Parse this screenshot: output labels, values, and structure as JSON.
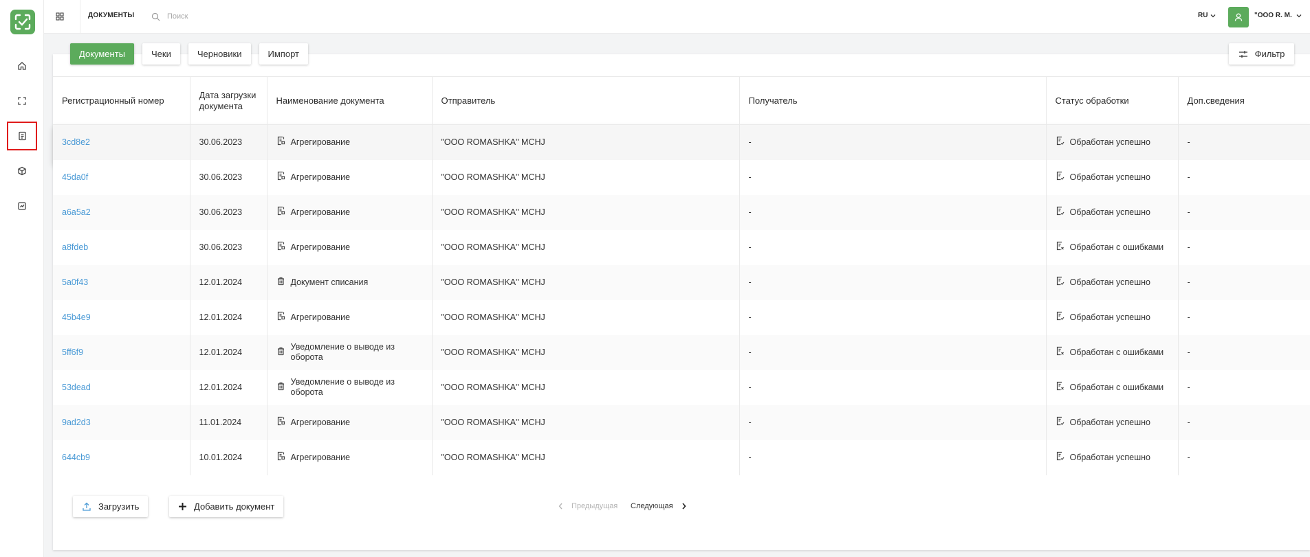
{
  "sidebar": {
    "logo": "check-frame-logo",
    "items": [
      {
        "icon": "home-icon"
      },
      {
        "icon": "scan-icon"
      },
      {
        "icon": "document-icon",
        "selected": true
      },
      {
        "icon": "box-icon"
      },
      {
        "icon": "report-icon"
      }
    ]
  },
  "header": {
    "title": "ДОКУМЕНТЫ",
    "search_placeholder": "Поиск",
    "lang": "RU",
    "user": "\"OOO R. M."
  },
  "tabs": [
    {
      "label": "Документы",
      "active": true
    },
    {
      "label": "Чеки",
      "active": false
    },
    {
      "label": "Черновики",
      "active": false
    },
    {
      "label": "Импорт",
      "active": false
    }
  ],
  "filter_label": "Фильтр",
  "table": {
    "columns": [
      "Регистрационный номер",
      "Дата загрузки документа",
      "Наименование документа",
      "Отправитель",
      "Получатель",
      "Статус обработки",
      "Доп.сведения"
    ],
    "rows": [
      {
        "reg": "3cd8e2",
        "date": "30.06.2023",
        "doc_icon": "aggregation-icon",
        "doc": "Агрегирование",
        "sender": "\"OOO ROMASHKA\" MCHJ",
        "recipient": "-",
        "status_icon": "status-ok-icon",
        "status": "Обработан успешно",
        "extra": "-"
      },
      {
        "reg": "45da0f",
        "date": "30.06.2023",
        "doc_icon": "aggregation-icon",
        "doc": "Агрегирование",
        "sender": "\"OOO ROMASHKA\" MCHJ",
        "recipient": "-",
        "status_icon": "status-ok-icon",
        "status": "Обработан успешно",
        "extra": "-"
      },
      {
        "reg": "a6a5a2",
        "date": "30.06.2023",
        "doc_icon": "aggregation-icon",
        "doc": "Агрегирование",
        "sender": "\"OOO ROMASHKA\" MCHJ",
        "recipient": "-",
        "status_icon": "status-ok-icon",
        "status": "Обработан успешно",
        "extra": "-"
      },
      {
        "reg": "a8fdeb",
        "date": "30.06.2023",
        "doc_icon": "aggregation-icon",
        "doc": "Агрегирование",
        "sender": "\"OOO ROMASHKA\" MCHJ",
        "recipient": "-",
        "status_icon": "status-error-icon",
        "status": "Обработан с ошибками",
        "extra": "-"
      },
      {
        "reg": "5a0f43",
        "date": "12.01.2024",
        "doc_icon": "trash-icon",
        "doc": "Документ списания",
        "sender": "\"OOO ROMASHKA\" MCHJ",
        "recipient": "-",
        "status_icon": "status-ok-icon",
        "status": "Обработан успешно",
        "extra": "-"
      },
      {
        "reg": "45b4e9",
        "date": "12.01.2024",
        "doc_icon": "aggregation-icon",
        "doc": "Агрегирование",
        "sender": "\"OOO ROMASHKA\" MCHJ",
        "recipient": "-",
        "status_icon": "status-ok-icon",
        "status": "Обработан успешно",
        "extra": "-"
      },
      {
        "reg": "5ff6f9",
        "date": "12.01.2024",
        "doc_icon": "trash-icon",
        "doc": "Уведомление о выводе из оборота",
        "sender": "\"OOO ROMASHKA\" MCHJ",
        "recipient": "-",
        "status_icon": "status-error-icon",
        "status": "Обработан с ошибками",
        "extra": "-"
      },
      {
        "reg": "53dead",
        "date": "12.01.2024",
        "doc_icon": "trash-icon",
        "doc": "Уведомление о выводе из оборота",
        "sender": "\"OOO ROMASHKA\" MCHJ",
        "recipient": "-",
        "status_icon": "status-error-icon",
        "status": "Обработан с ошибками",
        "extra": "-"
      },
      {
        "reg": "9ad2d3",
        "date": "11.01.2024",
        "doc_icon": "aggregation-icon",
        "doc": "Агрегирование",
        "sender": "\"OOO ROMASHKA\" MCHJ",
        "recipient": "-",
        "status_icon": "status-ok-icon",
        "status": "Обработан успешно",
        "extra": "-"
      },
      {
        "reg": "644cb9",
        "date": "10.01.2024",
        "doc_icon": "aggregation-icon",
        "doc": "Агрегирование",
        "sender": "\"OOO ROMASHKA\" MCHJ",
        "recipient": "-",
        "status_icon": "status-ok-icon",
        "status": "Обработан успешно",
        "extra": "-"
      }
    ]
  },
  "footer": {
    "upload_label": "Загрузить",
    "add_label": "Добавить документ",
    "prev_label": "Предыдущая",
    "next_label": "Следующая"
  },
  "colors": {
    "accent": "#5cab5c",
    "link": "#4a9ad6",
    "selected_outline": "#e01b1b"
  }
}
